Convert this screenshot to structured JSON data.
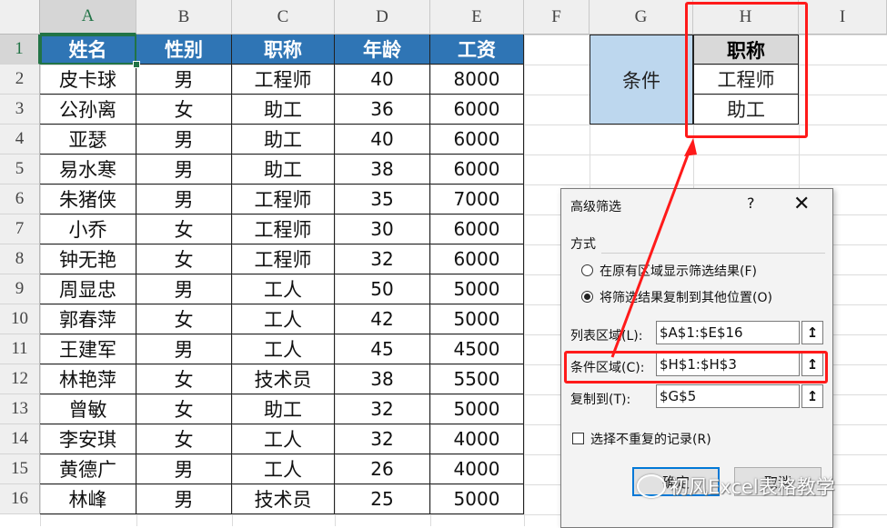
{
  "columns": [
    "A",
    "B",
    "C",
    "D",
    "E",
    "F",
    "G",
    "H",
    "I"
  ],
  "rows": [
    "1",
    "2",
    "3",
    "4",
    "5",
    "6",
    "7",
    "8",
    "9",
    "10",
    "11",
    "12",
    "13",
    "14",
    "15",
    "16"
  ],
  "table": {
    "headers": [
      "姓名",
      "性别",
      "职称",
      "年龄",
      "工资"
    ],
    "rows": [
      [
        "皮卡球",
        "男",
        "工程师",
        "40",
        "8000"
      ],
      [
        "公孙离",
        "女",
        "助工",
        "36",
        "6000"
      ],
      [
        "亚瑟",
        "男",
        "助工",
        "40",
        "6000"
      ],
      [
        "易水寒",
        "男",
        "助工",
        "38",
        "6000"
      ],
      [
        "朱猪侠",
        "男",
        "工程师",
        "35",
        "7000"
      ],
      [
        "小乔",
        "女",
        "工程师",
        "30",
        "6000"
      ],
      [
        "钟无艳",
        "女",
        "工程师",
        "32",
        "6000"
      ],
      [
        "周显忠",
        "男",
        "工人",
        "50",
        "5000"
      ],
      [
        "郭春萍",
        "女",
        "工人",
        "42",
        "5000"
      ],
      [
        "王建军",
        "男",
        "工人",
        "45",
        "4500"
      ],
      [
        "林艳萍",
        "女",
        "技术员",
        "38",
        "5500"
      ],
      [
        "曾敏",
        "女",
        "助工",
        "32",
        "5000"
      ],
      [
        "李安琪",
        "女",
        "工人",
        "32",
        "4000"
      ],
      [
        "黄德广",
        "男",
        "工人",
        "26",
        "4000"
      ],
      [
        "林峰",
        "男",
        "技术员",
        "25",
        "5000"
      ]
    ]
  },
  "criteria": {
    "label": "条件",
    "header": "职称",
    "values": [
      "工程师",
      "助工"
    ]
  },
  "dialog": {
    "title": "高级筛选",
    "help": "?",
    "close": "✕",
    "group_label": "方式",
    "option1": "在原有区域显示筛选结果(F)",
    "option2": "将筛选结果复制到其他位置(O)",
    "list_label": "列表区域(L):",
    "list_value": "$A$1:$E$16",
    "criteria_label": "条件区域(C):",
    "criteria_value": "$H$1:$H$3",
    "copy_label": "复制到(T):",
    "copy_value": "$G$5",
    "unique_label": "选择不重复的记录(R)",
    "ok": "确定",
    "cancel": "取消",
    "range_btn": "↥"
  },
  "watermark": "初风Excel表格教学",
  "colors": {
    "header_blue": "#2f75b5",
    "criteria_blue": "#bdd7ee",
    "highlight_red": "#ff1a1a",
    "excel_green": "#217346"
  }
}
